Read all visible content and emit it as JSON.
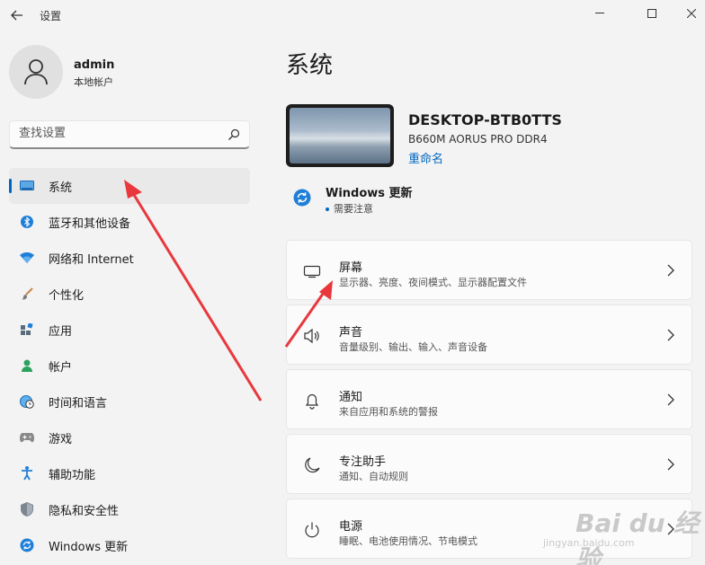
{
  "window": {
    "title": "设置",
    "back_icon": "back-arrow-icon",
    "minimize_icon": "minimize-icon",
    "maximize_icon": "maximize-icon",
    "close_icon": "close-icon"
  },
  "profile": {
    "name": "admin",
    "account_type": "本地帐户"
  },
  "search": {
    "placeholder": "查找设置"
  },
  "sidebar": {
    "items": [
      {
        "label": "系统",
        "icon": "display-system-icon",
        "active": true
      },
      {
        "label": "蓝牙和其他设备",
        "icon": "bluetooth-icon"
      },
      {
        "label": "网络和 Internet",
        "icon": "wifi-icon"
      },
      {
        "label": "个性化",
        "icon": "paintbrush-icon"
      },
      {
        "label": "应用",
        "icon": "apps-icon"
      },
      {
        "label": "帐户",
        "icon": "account-icon"
      },
      {
        "label": "时间和语言",
        "icon": "globe-clock-icon"
      },
      {
        "label": "游戏",
        "icon": "gamepad-icon"
      },
      {
        "label": "辅助功能",
        "icon": "accessibility-icon"
      },
      {
        "label": "隐私和安全性",
        "icon": "shield-icon"
      },
      {
        "label": "Windows 更新",
        "icon": "windows-update-icon"
      }
    ]
  },
  "main": {
    "title": "系统",
    "device": {
      "name": "DESKTOP-BTB0TTS",
      "model": "B660M AORUS PRO DDR4",
      "rename": "重命名"
    },
    "windows_update": {
      "title": "Windows 更新",
      "status": "需要注意"
    },
    "cards": [
      {
        "title": "屏幕",
        "subtitle": "显示器、亮度、夜间模式、显示器配置文件",
        "icon": "monitor-icon"
      },
      {
        "title": "声音",
        "subtitle": "音量级别、输出、输入、声音设备",
        "icon": "speaker-icon"
      },
      {
        "title": "通知",
        "subtitle": "来自应用和系统的警报",
        "icon": "bell-icon"
      },
      {
        "title": "专注助手",
        "subtitle": "通知、自动规则",
        "icon": "moon-icon"
      },
      {
        "title": "电源",
        "subtitle": "睡眠、电池使用情况、节电模式",
        "icon": "power-icon"
      }
    ]
  },
  "colors": {
    "accent": "#0067c0",
    "background": "#f3f3f3",
    "card": "#fbfbfb",
    "annotation_arrow": "#e8383d"
  },
  "watermark": {
    "brand": "Bai du 经验",
    "url": "jingyan.baidu.com"
  }
}
